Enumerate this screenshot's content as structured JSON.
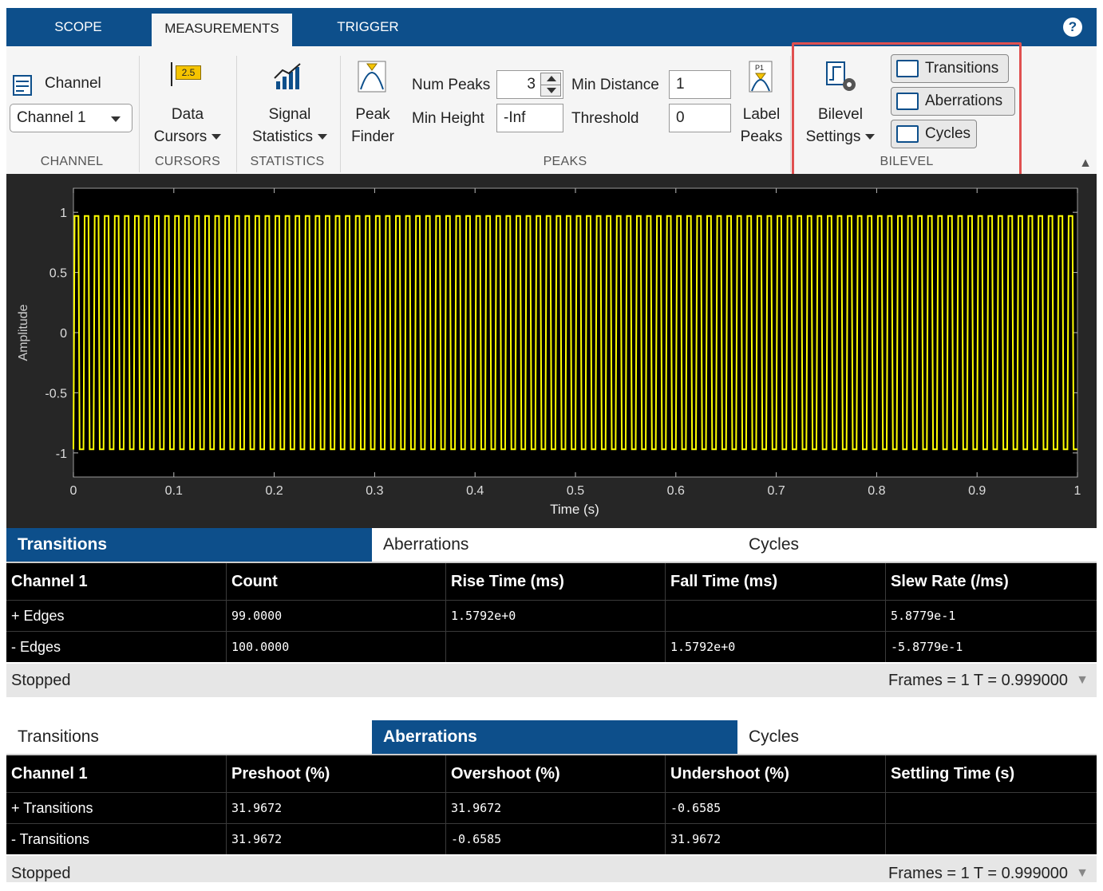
{
  "tabs": [
    {
      "label": "SCOPE"
    },
    {
      "label": "MEASUREMENTS"
    },
    {
      "label": "TRIGGER"
    }
  ],
  "help_label": "?",
  "toolstrip": {
    "channel": {
      "button_label": "Channel",
      "dropdown_value": "Channel 1",
      "section_label": "CHANNEL"
    },
    "cursors": {
      "badge": "2.5",
      "label_line1": "Data",
      "label_line2": "Cursors",
      "section_label": "CURSORS"
    },
    "statistics": {
      "label_line1": "Signal",
      "label_line2": "Statistics",
      "section_label": "STATISTICS"
    },
    "peaks": {
      "peak_finder_line1": "Peak",
      "peak_finder_line2": "Finder",
      "num_peaks_label": "Num Peaks",
      "num_peaks_value": "3",
      "min_height_label": "Min Height",
      "min_height_value": "-Inf",
      "min_distance_label": "Min Distance",
      "min_distance_value": "1",
      "threshold_label": "Threshold",
      "threshold_value": "0",
      "label_peaks_line1": "Label",
      "label_peaks_line2": "Peaks",
      "label_peaks_badge": "P1",
      "section_label": "PEAKS"
    },
    "bilevel": {
      "settings_line1": "Bilevel",
      "settings_line2": "Settings",
      "transitions_label": "Transitions",
      "aberrations_label": "Aberrations",
      "cycles_label": "Cycles",
      "section_label": "BILEVEL"
    }
  },
  "chart_data": {
    "type": "line",
    "title": "",
    "xlabel": "Time (s)",
    "ylabel": "Amplitude",
    "xlim": [
      0,
      1
    ],
    "ylim": [
      -1.2,
      1.2
    ],
    "x_ticks": [
      "0",
      "0.1",
      "0.2",
      "0.3",
      "0.4",
      "0.5",
      "0.6",
      "0.7",
      "0.8",
      "0.9",
      "1"
    ],
    "y_ticks": [
      "1",
      "0.5",
      "0",
      "-0.5",
      "-1"
    ],
    "y_tick_values": [
      1,
      0.5,
      0,
      -0.5,
      -1
    ],
    "series": [
      {
        "waveform": "trapezoidal pulse train",
        "cycles": 100,
        "high": 0.97,
        "low": -0.97,
        "color": "#ffff00"
      }
    ],
    "background": "#000000",
    "grid": false
  },
  "panel1": {
    "tabs": [
      {
        "label": "Transitions"
      },
      {
        "label": "Aberrations"
      },
      {
        "label": "Cycles"
      }
    ],
    "active_tab": "Transitions",
    "headers": [
      "Channel 1",
      "Count",
      "Rise Time (ms)",
      "Fall Time (ms)",
      "Slew Rate (/ms)"
    ],
    "rows": [
      [
        "+ Edges",
        "99.0000",
        "1.5792e+0",
        "",
        "5.8779e-1"
      ],
      [
        "- Edges",
        "100.0000",
        "",
        "1.5792e+0",
        "-5.8779e-1"
      ]
    ],
    "status_left": "Stopped",
    "status_right": "Frames = 1  T = 0.999000"
  },
  "panel2": {
    "tabs": [
      {
        "label": "Transitions"
      },
      {
        "label": "Aberrations"
      },
      {
        "label": "Cycles"
      }
    ],
    "active_tab": "Aberrations",
    "headers": [
      "Channel 1",
      "Preshoot (%)",
      "Overshoot (%)",
      "Undershoot (%)",
      "Settling Time (s)"
    ],
    "rows": [
      [
        "+ Transitions",
        "31.9672",
        "31.9672",
        "-0.6585",
        ""
      ],
      [
        "- Transitions",
        "31.9672",
        "-0.6585",
        "31.9672",
        ""
      ]
    ],
    "status_left": "Stopped",
    "status_right": "Frames = 1  T = 0.999000"
  },
  "colors": {
    "accent": "#0d4f8b",
    "highlight": "#e05050",
    "trace": "#ffff00",
    "plot_bg": "#000000"
  }
}
